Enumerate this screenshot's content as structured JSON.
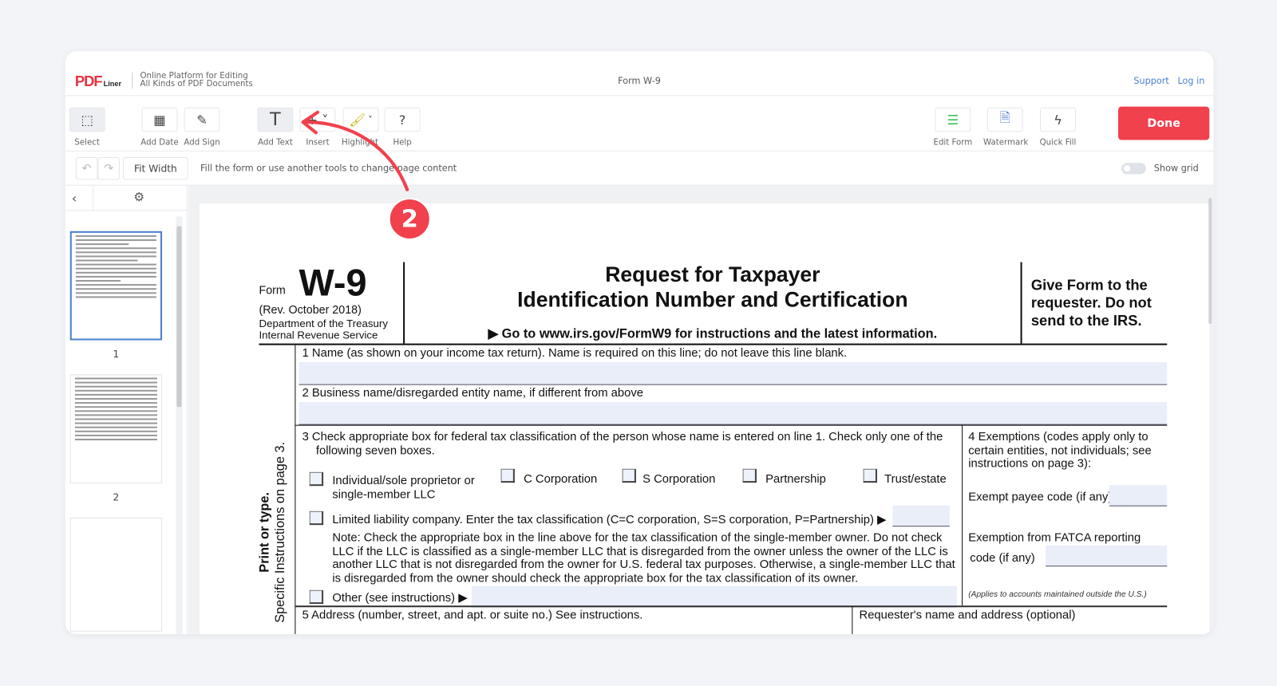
{
  "header": {
    "logo": "PDFLiner",
    "logo_main": "PDF",
    "logo_sub": "Liner",
    "tagline_1": "Online Platform for Editing",
    "tagline_2": "All Kinds of PDF Documents",
    "doc_title": "Form W-9",
    "support": "Support",
    "login": "Log in"
  },
  "toolbar": {
    "select": "Select",
    "add_date": "Add Date",
    "add_sign": "Add Sign",
    "add_text": "Add Text",
    "insert": "Insert",
    "highlight": "Highlight",
    "help": "Help",
    "edit_form": "Edit Form",
    "watermark": "Watermark",
    "quick_fill": "Quick Fill",
    "done": "Done"
  },
  "subbar": {
    "fit_width": "Fit Width",
    "hint": "Fill the form or use another tools to change page content",
    "show_grid": "Show grid",
    "show_grid_on": false
  },
  "sidebar": {
    "pages": [
      "1",
      "2"
    ],
    "selected": "1"
  },
  "annotation": {
    "step": "2",
    "color": "#f0414d"
  },
  "form": {
    "form_label": "Form",
    "form_number": "W-9",
    "rev": "(Rev. October 2018)",
    "dept": "Department of the Treasury",
    "irs": "Internal Revenue Service",
    "title_1": "Request for Taxpayer",
    "title_2": "Identification Number and Certification",
    "goto": "▶ Go to www.irs.gov/FormW9 for instructions and the latest information.",
    "give": "Give Form to the requester. Do not send to the IRS.",
    "side_1": "Print or type.",
    "side_2": "Specific Instructions on page 3.",
    "line1": "1  Name (as shown on your income tax return). Name is required on this line; do not leave this line blank.",
    "line2": "2  Business name/disregarded entity name, if different from above",
    "line3a": "3  Check appropriate box for federal tax classification of the person whose name is entered on line 1. Check only one of the",
    "line3b": "following seven boxes.",
    "cb_individual_1": "Individual/sole proprietor or",
    "cb_individual_2": "single-member LLC",
    "cb_c": "C Corporation",
    "cb_s": "S Corporation",
    "cb_partnership": "Partnership",
    "cb_trust": "Trust/estate",
    "cb_llc": "Limited liability company. Enter the tax classification (C=C corporation, S=S corporation, P=Partnership) ▶",
    "note_1": "Note: Check the appropriate box in the line above for the tax classification of the single-member owner.  Do not check",
    "note_2": "LLC if the LLC is classified as a single-member LLC that is disregarded from the owner unless the owner of the LLC is",
    "note_3": "another LLC that is not disregarded from the owner for U.S. federal tax purposes. Otherwise, a single-member LLC that",
    "note_4": "is disregarded from the owner should check the appropriate box for the tax classification of its owner.",
    "cb_other": "Other (see instructions) ▶",
    "ex_1": "4  Exemptions (codes apply only to",
    "ex_2": "certain entities, not individuals; see",
    "ex_3": "instructions on page 3):",
    "exempt_payee": "Exempt payee code (if any)",
    "fatca_1": "Exemption from FATCA reporting",
    "fatca_2": "code (if any)",
    "applies": "(Applies to accounts maintained outside the U.S.)",
    "line5": "5  Address (number, street, and apt. or suite no.) See instructions.",
    "requester": "Requester's name and address (optional)"
  }
}
